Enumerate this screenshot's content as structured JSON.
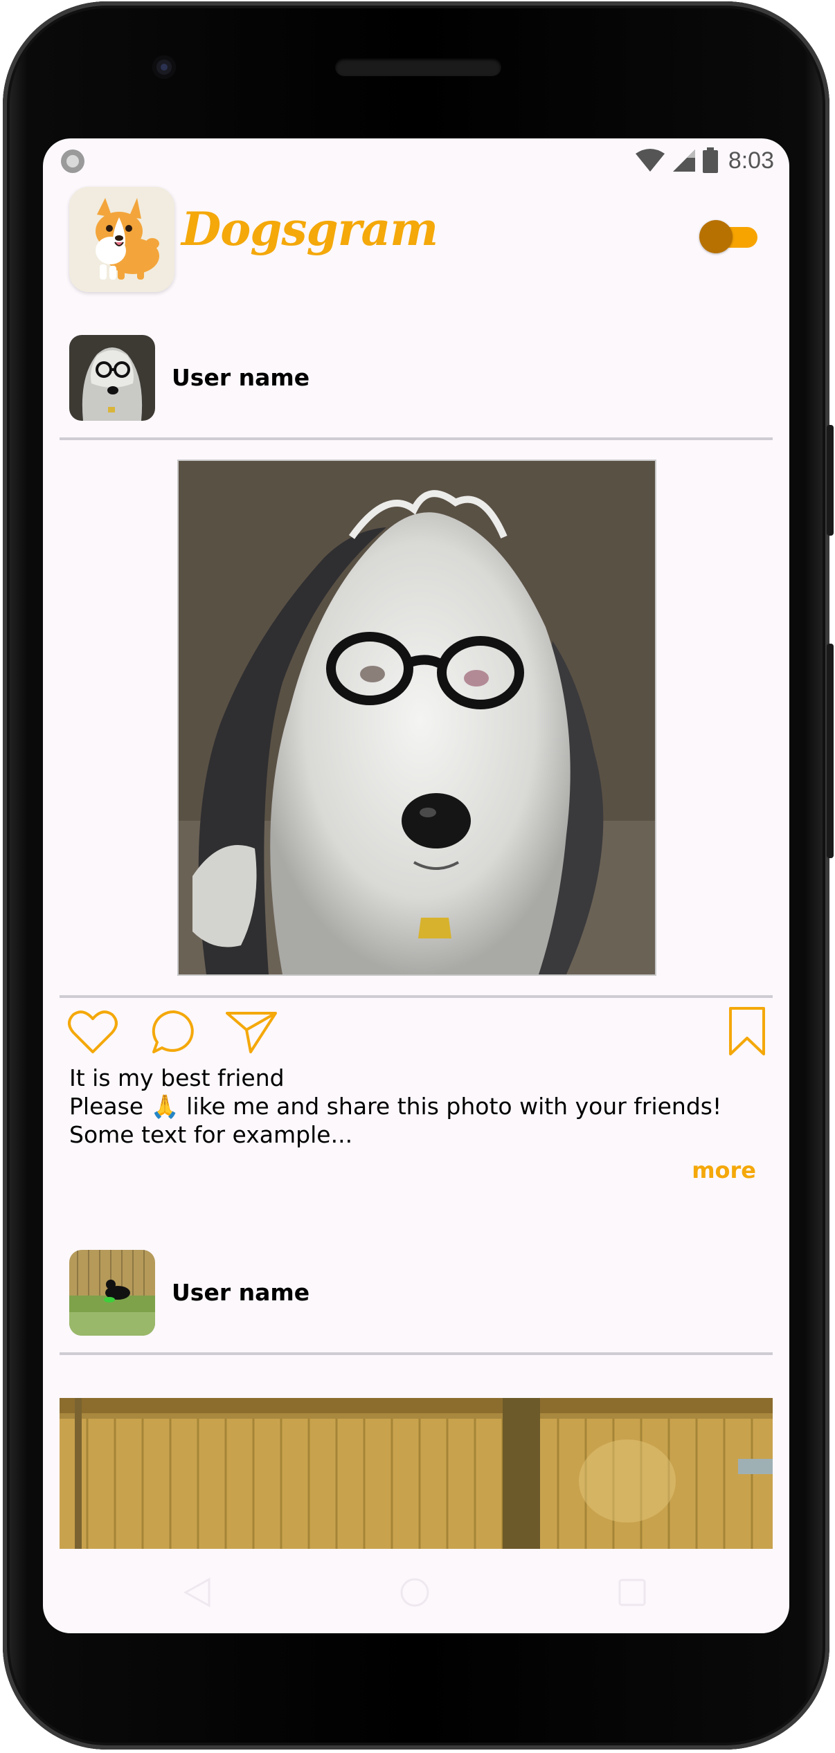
{
  "status_bar": {
    "time": "8:03",
    "icons": [
      "record-icon",
      "wifi-icon",
      "signal-icon",
      "battery-icon"
    ]
  },
  "header": {
    "app_name": "Dogsgram",
    "logo": "corgi-logo",
    "theme_toggle": {
      "state": "on"
    }
  },
  "colors": {
    "accent": "#f4a80a",
    "toggle_thumb": "#b77100",
    "background": "#fcf8fc",
    "divider": "#cfcdd3"
  },
  "posts": [
    {
      "username": "User name",
      "avatar": "dog-with-glasses",
      "image": "sheepdog-wearing-glasses",
      "actions": [
        "heart-icon",
        "comment-icon",
        "send-icon",
        "bookmark-icon"
      ],
      "caption_lines": [
        "It is my best friend",
        "Please 🙏 like me and share this photo with your friends!",
        "Some text for example..."
      ],
      "more_label": "more"
    },
    {
      "username": "User name",
      "avatar": "dog-in-backyard",
      "image": "wooden-fence"
    }
  ],
  "nav_bar": {
    "buttons": [
      "back-icon",
      "home-icon",
      "recents-icon"
    ]
  }
}
